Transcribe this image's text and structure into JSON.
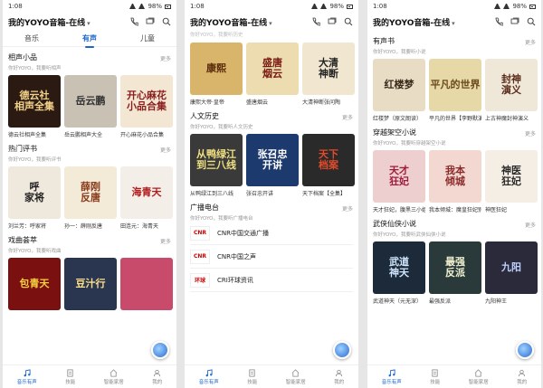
{
  "status": {
    "time": "1:08",
    "battery": "98%"
  },
  "header": {
    "title": "我的YOYO音箱-在线"
  },
  "tabs": [
    "音乐",
    "有声",
    "儿童"
  ],
  "more": "更多",
  "p1": {
    "sections": [
      {
        "title": "相声小品",
        "sub": "你好YOYO，我要听相声",
        "items": [
          {
            "cap": "德云社相声全集",
            "text": "德云社\n相声全集",
            "bg": "#2a1a12",
            "fg": "#f2d18a"
          },
          {
            "cap": "岳云鹏相声大全",
            "text": "岳云鹏",
            "bg": "#c9c1b4",
            "fg": "#333"
          },
          {
            "cap": "开心麻花小品合集",
            "text": "开心麻花\n小品合集",
            "bg": "#f3e6d2",
            "fg": "#8a1e1e"
          }
        ]
      },
      {
        "title": "热门评书",
        "sub": "你好YOYO，我要听评书",
        "items": [
          {
            "cap": "刘兰芳：呼家将",
            "text": "呼\n家将",
            "bg": "#efe8dd",
            "fg": "#222"
          },
          {
            "cap": "孙一：薛刚反唐",
            "text": "薛刚\n反唐",
            "bg": "#f4ead8",
            "fg": "#8a3a1a"
          },
          {
            "cap": "田连元：海青天",
            "text": "海青天",
            "bg": "#f3eee8",
            "fg": "#b21c1c"
          }
        ]
      },
      {
        "title": "戏曲荟萃",
        "sub": "你好YOYO，我要听戏曲",
        "items": [
          {
            "cap": "",
            "text": "包青天",
            "bg": "#7a1010",
            "fg": "#f7d040"
          },
          {
            "cap": "",
            "text": "豆汁行",
            "bg": "#2a3550",
            "fg": "#ffe08a"
          },
          {
            "cap": "",
            "text": "",
            "bg": "#c84b6b",
            "fg": "#fff"
          }
        ]
      }
    ]
  },
  "p2": {
    "faded": "你好YOYO，我要听历史",
    "sections": [
      {
        "title": "",
        "sub": "",
        "items": [
          {
            "cap": "康熙大帝·皇帝",
            "text": "康熙",
            "bg": "#d8b56a",
            "fg": "#5a2a0a"
          },
          {
            "cap": "盛唐烟云",
            "text": "盛唐\n烟云",
            "bg": "#ecdcb0",
            "fg": "#7a1a12"
          },
          {
            "cap": "大清神断张问陶",
            "text": "大清\n神断",
            "bg": "#f1e6cf",
            "fg": "#222"
          }
        ]
      },
      {
        "title": "人文历史",
        "sub": "你好YOYO，我要听人文历史",
        "items": [
          {
            "cap": "从鸭绿江到三八线",
            "text": "从鸭绿江\n到三八线",
            "bg": "#3a3a3a",
            "fg": "#f0e080"
          },
          {
            "cap": "张召忠开讲",
            "text": "张召忠\n开讲",
            "bg": "#1d3a6e",
            "fg": "#fff"
          },
          {
            "cap": "天下档案【全集】",
            "text": "天下\n档案",
            "bg": "#2a2a2a",
            "fg": "#e34b2a"
          }
        ]
      }
    ],
    "radio": {
      "title": "广播电台",
      "sub": "你好YOYO，我要听广播电台",
      "items": [
        {
          "logo": "CNR",
          "name": "CNR中国交通广播"
        },
        {
          "logo": "CNR",
          "name": "CNR中国之声"
        },
        {
          "logo": "环球",
          "name": "CRI环球资讯"
        }
      ]
    }
  },
  "p3": {
    "sections": [
      {
        "title": "有声书",
        "sub": "你好YOYO，我要听小说",
        "items": [
          {
            "cap": "红楼梦（原文朗读）",
            "text": "红楼梦",
            "bg": "#e8dcc4",
            "fg": "#3a2a1a"
          },
          {
            "cap": "平凡的世界【李野默演播】",
            "text": "平凡的世界",
            "bg": "#e7d8a8",
            "fg": "#6a4a1a"
          },
          {
            "cap": "上古神魔封神演义",
            "text": "封神\n演义",
            "bg": "#efe8d8",
            "fg": "#5a2a1a"
          }
        ]
      },
      {
        "title": "穿越架空小说",
        "sub": "你好YOYO，我要听穿越架空小说",
        "items": [
          {
            "cap": "天才狂妃，腹黑三小姐",
            "text": "天才\n狂妃",
            "bg": "#eecfcf",
            "fg": "#a01a3a"
          },
          {
            "cap": "我本倾城：魔皇狂妃别冷王",
            "text": "我本\n倾城",
            "bg": "#f2d8d0",
            "fg": "#8a2a2a"
          },
          {
            "cap": "神医狂妃",
            "text": "神医\n狂妃",
            "bg": "#f4eee4",
            "fg": "#2a2a2a"
          }
        ]
      },
      {
        "title": "武侠仙侠小说",
        "sub": "你好YOYO，我要听武侠仙侠小说",
        "items": [
          {
            "cap": "武道神天（元无深）",
            "text": "武道\n神天",
            "bg": "#1d2a3a",
            "fg": "#d0e8ff"
          },
          {
            "cap": "最强反派",
            "text": "最强\n反派",
            "bg": "#2a3a3a",
            "fg": "#f0f0d0"
          },
          {
            "cap": "九阳神王",
            "text": "九阳",
            "bg": "#2a2a3a",
            "fg": "#c0d0ff"
          }
        ]
      }
    ]
  },
  "nav": [
    "音乐有声",
    "技能",
    "智能家居",
    "我的"
  ]
}
